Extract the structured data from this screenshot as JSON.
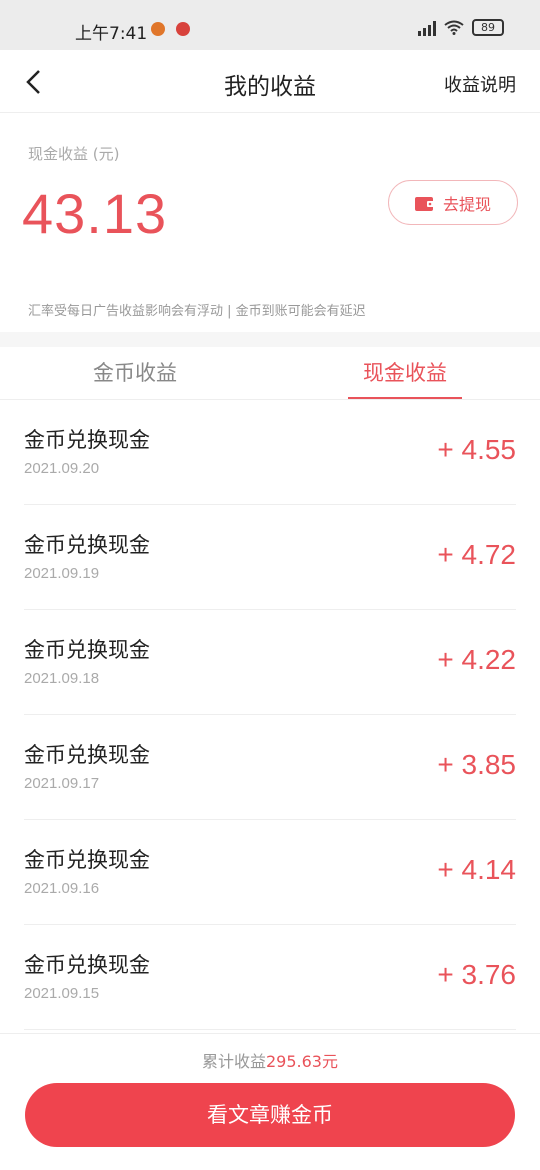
{
  "status_bar": {
    "time": "上午7:41",
    "battery": "89"
  },
  "header": {
    "title": "我的收益",
    "help_link": "收益说明"
  },
  "summary": {
    "label": "现金收益 (元)",
    "amount": "43.13",
    "withdraw_label": "去提现",
    "note": "汇率受每日广告收益影响会有浮动 | 金币到账可能会有延迟"
  },
  "tabs": [
    {
      "label": "金币收益",
      "active": false
    },
    {
      "label": "现金收益",
      "active": true
    }
  ],
  "records": [
    {
      "title": "金币兑换现金",
      "date": "2021.09.20",
      "amount": "+ 4.55"
    },
    {
      "title": "金币兑换现金",
      "date": "2021.09.19",
      "amount": "+ 4.72"
    },
    {
      "title": "金币兑换现金",
      "date": "2021.09.18",
      "amount": "+ 4.22"
    },
    {
      "title": "金币兑换现金",
      "date": "2021.09.17",
      "amount": "+ 3.85"
    },
    {
      "title": "金币兑换现金",
      "date": "2021.09.16",
      "amount": "+ 4.14"
    },
    {
      "title": "金币兑换现金",
      "date": "2021.09.15",
      "amount": "+ 3.76"
    }
  ],
  "footer": {
    "total_label": "累计收益",
    "total_value": "295.63元",
    "cta_label": "看文章赚金币"
  },
  "colors": {
    "accent": "#e9535a",
    "cta": "#ef444e"
  }
}
